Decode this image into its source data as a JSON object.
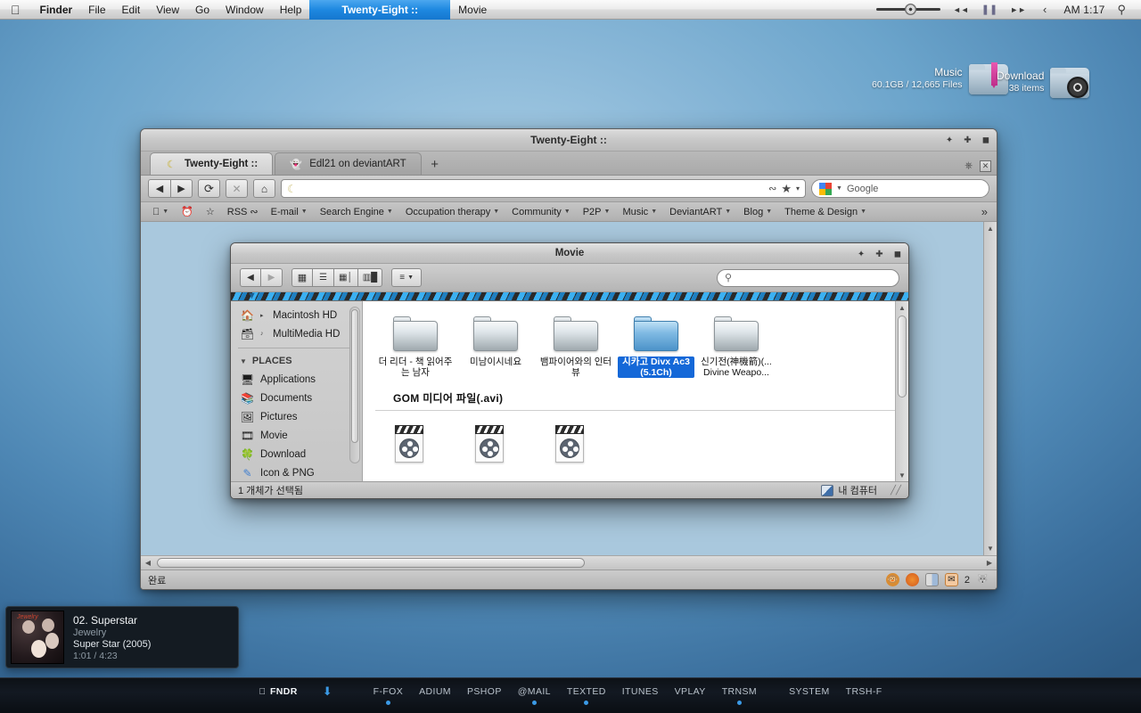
{
  "menubar": {
    "apple_icon": "apple-icon",
    "items": [
      "Finder",
      "File",
      "Edit",
      "View",
      "Go",
      "Window",
      "Help"
    ],
    "active_app": "Twenty-Eight ::",
    "secondary_app": "Movie",
    "right": {
      "volume_icon": "volume-slider",
      "prev_icon": "◄◄",
      "pause_icon": "❚❚",
      "next_icon": "►►",
      "chevron_icon": "‹",
      "clock": "AM 1:17",
      "search_icon": "search-icon"
    }
  },
  "desktop": {
    "stacks": [
      {
        "name": "Music",
        "detail": "60.1GB / 12,665 Files"
      },
      {
        "name": "Download",
        "detail": "38 items"
      }
    ]
  },
  "browser": {
    "title": "Twenty-Eight ::",
    "window_buttons": {
      "minimize": "✦",
      "maximize": "✚",
      "close": "◼"
    },
    "tabs": [
      {
        "label": "Twenty-Eight ::",
        "icon": "moon-icon",
        "active": true
      },
      {
        "label": "Edl21 on deviantART",
        "icon": "deviantart-mascot-icon",
        "active": false
      }
    ],
    "new_tab_label": "+",
    "toolbar": {
      "back": "◀",
      "forward": "▶",
      "reload": "⟳",
      "stop": "✕",
      "home": "⌂",
      "url_value": "",
      "url_icon": "moon-icon",
      "rss_icon": "ℝ",
      "bookmark_star": "★",
      "bookmark_caret": "▾",
      "search_engine": "Google",
      "search_placeholder": "Google"
    },
    "bookmarks": [
      {
        "label": "",
        "icon": "apple-icon",
        "caret": true
      },
      {
        "label": "",
        "icon": "history-icon",
        "caret": false
      },
      {
        "label": "",
        "icon": "star-icon",
        "caret": false
      },
      {
        "label": "RSS",
        "icon": "rss-icon",
        "caret": false
      },
      {
        "label": "E-mail",
        "icon": "",
        "caret": true
      },
      {
        "label": "Search Engine",
        "icon": "",
        "caret": true
      },
      {
        "label": "Occupation therapy",
        "icon": "",
        "caret": true
      },
      {
        "label": "Community",
        "icon": "",
        "caret": true
      },
      {
        "label": "P2P",
        "icon": "",
        "caret": true
      },
      {
        "label": "Music",
        "icon": "",
        "caret": true
      },
      {
        "label": "DeviantART",
        "icon": "",
        "caret": true
      },
      {
        "label": "Blog",
        "icon": "",
        "caret": true
      },
      {
        "label": "Theme & Design",
        "icon": "",
        "caret": true
      }
    ],
    "bookmarks_overflow": "»",
    "status": {
      "text": "완료",
      "icons": [
        "monkey-icon",
        "firefox-icon",
        "panel-icon",
        "mail-icon"
      ],
      "mail_count": "2",
      "last_icon": "fox-icon"
    }
  },
  "finder": {
    "title": "Movie",
    "window_buttons": {
      "minimize": "✦",
      "maximize": "✚",
      "close": "◼"
    },
    "toolbar": {
      "back": "◀",
      "forward": "▶",
      "view_icon": "⊞",
      "view_list": "☰",
      "view_column": "▥",
      "view_coverflow": "▤",
      "action": "≡",
      "action_caret": "▾",
      "search_placeholder": ""
    },
    "sidebar": {
      "devices": [
        {
          "label": "Macintosh HD",
          "icon": "house-icon",
          "disclosure": "▸"
        },
        {
          "label": "MultiMedia HD",
          "icon": "drive-icon",
          "badge": "♪"
        }
      ],
      "places_header": "PLACES",
      "places": [
        {
          "label": "Applications",
          "icon": "display-icon"
        },
        {
          "label": "Documents",
          "icon": "books-icon"
        },
        {
          "label": "Pictures",
          "icon": "picture-frame-icon"
        },
        {
          "label": "Movie",
          "icon": "film-reel-icon"
        },
        {
          "label": "Download",
          "icon": "clover-icon"
        },
        {
          "label": "Icon & PNG",
          "icon": "pen-icon"
        }
      ]
    },
    "folders": [
      {
        "label": "더 리더 - 책 읽어주는 남자",
        "selected": false
      },
      {
        "label": "미남이시네요",
        "selected": false
      },
      {
        "label": "뱀파이어와의 인터뷰",
        "selected": false
      },
      {
        "label": "시카고 Divx Ac3 (5.1Ch)",
        "selected": true
      },
      {
        "label": "신기전(神機箭)(... Divine Weapo...",
        "selected": false
      }
    ],
    "group_header": "GOM 미디어 파일(.avi)",
    "media_files": [
      {
        "label": "",
        "icon": "movie-file-icon"
      },
      {
        "label": "",
        "icon": "movie-file-icon"
      },
      {
        "label": "",
        "icon": "movie-file-icon"
      }
    ],
    "status": {
      "left": "1 개체가 선택됨",
      "right": "내 컴퓨터",
      "right_icon": "computer-icon"
    }
  },
  "now_playing": {
    "track": "02. Superstar",
    "artist": "Jewelry",
    "album": "Super Star (2005)",
    "time": "1:01 / 4:23",
    "art_label": "Jewelry"
  },
  "dock": {
    "finder_label": "FNDR",
    "finder_icon": "apple-icon",
    "download_arrow": "⬇",
    "items": [
      "F-FOX",
      "ADIUM",
      "PSHOP",
      "@MAIL",
      "TEXTED",
      "ITUNES",
      "VPLAY",
      "TRNSM"
    ],
    "system_label": "SYSTEM",
    "trash_label": "TRSH-F"
  }
}
